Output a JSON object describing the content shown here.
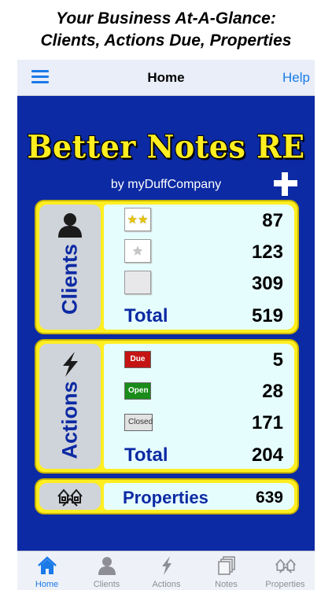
{
  "caption": {
    "line1": "Your Business At-A-Glance:",
    "line2": "Clients, Actions Due, Properties"
  },
  "navbar": {
    "title": "Home",
    "help": "Help",
    "menu_icon": "hamburger-menu-icon"
  },
  "app": {
    "title": "Better Notes RE",
    "byline": "by myDuffCompany"
  },
  "clients": {
    "label": "Clients",
    "rows": [
      {
        "stars": 2,
        "count": "87"
      },
      {
        "stars": 1,
        "count": "123"
      },
      {
        "stars": 0,
        "count": "309"
      }
    ],
    "total_label": "Total",
    "total": "519"
  },
  "actions": {
    "label": "Actions",
    "rows": [
      {
        "status": "Due",
        "count": "5"
      },
      {
        "status": "Open",
        "count": "28"
      },
      {
        "status": "Closed",
        "count": "171"
      }
    ],
    "total_label": "Total",
    "total": "204"
  },
  "properties": {
    "label": "Properties",
    "count": "639"
  },
  "tabs": [
    {
      "label": "Home",
      "icon": "house-icon",
      "active": true
    },
    {
      "label": "Clients",
      "icon": "person-icon",
      "active": false
    },
    {
      "label": "Actions",
      "icon": "lightning-icon",
      "active": false
    },
    {
      "label": "Notes",
      "icon": "notes-stack-icon",
      "active": false
    },
    {
      "label": "Properties",
      "icon": "houses-icon",
      "active": false
    }
  ],
  "colors": {
    "background_blue": "#0c2aa3",
    "panel_yellow": "#ffee20",
    "panel_body": "#e6fdfe",
    "accent": "#1a7ae8",
    "due": "#c41414",
    "open": "#1a8c1a"
  }
}
